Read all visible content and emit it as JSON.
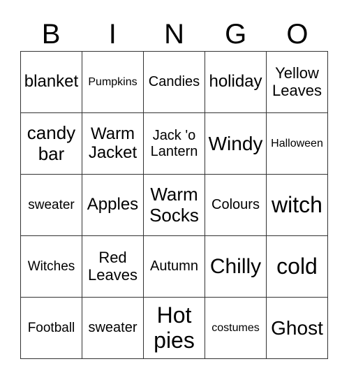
{
  "header": [
    "B",
    "I",
    "N",
    "G",
    "O"
  ],
  "cells": [
    [
      "blanket",
      "Pumpkins",
      "Candies",
      "holiday",
      "Yellow Leaves"
    ],
    [
      "candy bar",
      "Warm Jacket",
      "Jack 'o Lantern",
      "Windy",
      "Halloween"
    ],
    [
      "sweater",
      "Apples",
      "Warm Socks",
      "Colours",
      "witch"
    ],
    [
      "Witches",
      "Red Leaves",
      "Autumn",
      "Chilly",
      "cold"
    ],
    [
      "Football",
      "sweater",
      "Hot pies",
      "costumes",
      "Ghost"
    ]
  ]
}
